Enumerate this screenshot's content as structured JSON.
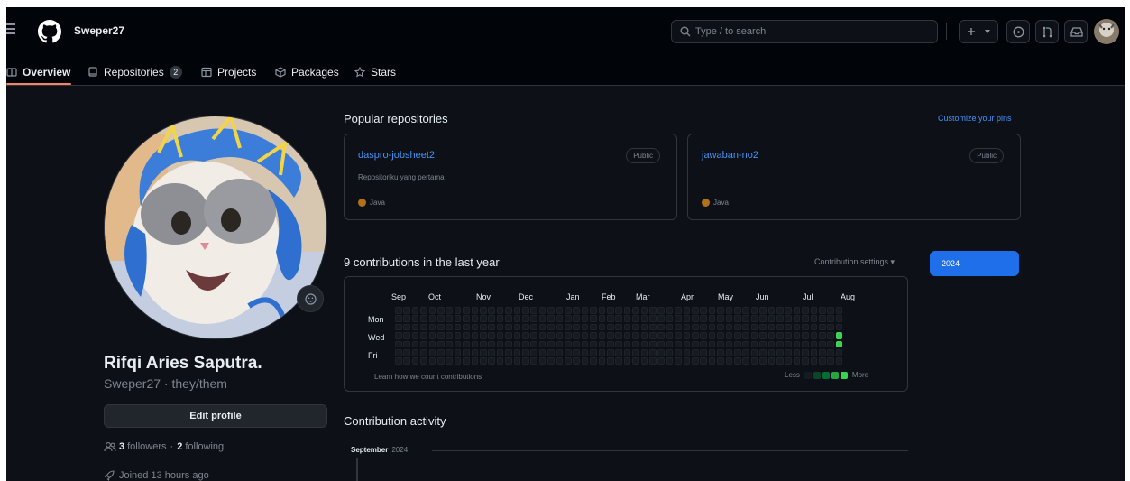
{
  "header": {
    "username": "Sweper27",
    "search_placeholder": "Type / to search",
    "icons": [
      "menu-icon",
      "github-logo-icon",
      "search-icon",
      "plus-icon",
      "triangle-down-icon",
      "issues-icon",
      "pull-request-icon",
      "inbox-icon"
    ]
  },
  "tabs": [
    {
      "label": "Overview",
      "icon": "book-icon",
      "active": true
    },
    {
      "label": "Repositories",
      "icon": "repo-icon",
      "count": "2"
    },
    {
      "label": "Projects",
      "icon": "table-icon"
    },
    {
      "label": "Packages",
      "icon": "package-icon"
    },
    {
      "label": "Stars",
      "icon": "star-icon"
    }
  ],
  "profile": {
    "full_name": "Rifqi Aries Saputra.",
    "handle": "Sweper27 · they/them",
    "edit_label": "Edit profile",
    "followers_count": "3",
    "followers_label": "followers",
    "separator": "·",
    "following_count": "2",
    "following_label": "following",
    "joined": "Joined 13 hours ago"
  },
  "popular": {
    "title": "Popular repositories",
    "customize": "Customize your pins",
    "repos": [
      {
        "name": "daspro-jobsheet2",
        "visibility": "Public",
        "description": "Repositoriku yang pertama",
        "language": "Java",
        "language_color": "#b07219"
      },
      {
        "name": "jawaban-no2",
        "visibility": "Public",
        "description": "",
        "language": "Java",
        "language_color": "#b07219"
      }
    ]
  },
  "contributions": {
    "title": "9 contributions in the last year",
    "settings": "Contribution settings ▾",
    "year": "2024",
    "months": [
      "Sep",
      "Oct",
      "Nov",
      "Dec",
      "Jan",
      "Feb",
      "Mar",
      "Apr",
      "May",
      "Jun",
      "Jul",
      "Aug"
    ],
    "days": [
      "Mon",
      "Wed",
      "Fri"
    ],
    "learn": "Learn how we count contributions",
    "less": "Less",
    "more": "More",
    "colors": {
      "empty": "#161b22",
      "l1": "#0e4429",
      "l2": "#006d32",
      "l3": "#26a641",
      "l4": "#39d353"
    }
  },
  "activity": {
    "title": "Contribution activity",
    "month": "September",
    "year": "2024"
  }
}
